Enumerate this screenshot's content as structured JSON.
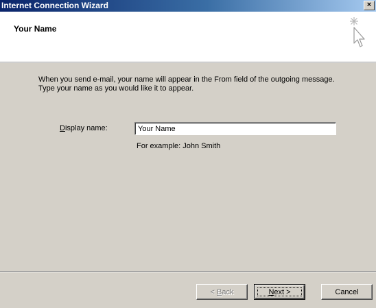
{
  "window": {
    "title": "Internet Connection Wizard",
    "close_glyph": "×"
  },
  "header": {
    "heading": "Your Name",
    "icon": "wizard-sparkle-cursor-icon"
  },
  "body": {
    "line1": "When you send e-mail, your name will appear in the From field of the outgoing message.",
    "line2": "Type your name as you would like it to appear."
  },
  "display_name": {
    "label_accel": "D",
    "label_rest": "isplay name:",
    "value": "Your Name",
    "example": "For example: John Smith"
  },
  "buttons": {
    "back": {
      "prefix": "< ",
      "accel": "B",
      "rest": "ack",
      "enabled": false
    },
    "next": {
      "accel": "N",
      "rest": "ext >",
      "enabled": true,
      "default": true
    },
    "cancel": {
      "label": "Cancel",
      "enabled": true
    }
  },
  "colors": {
    "titlebar_start": "#0a246a",
    "titlebar_end": "#a6caf0",
    "face": "#d4d0c8",
    "header_bg": "#ffffff"
  }
}
